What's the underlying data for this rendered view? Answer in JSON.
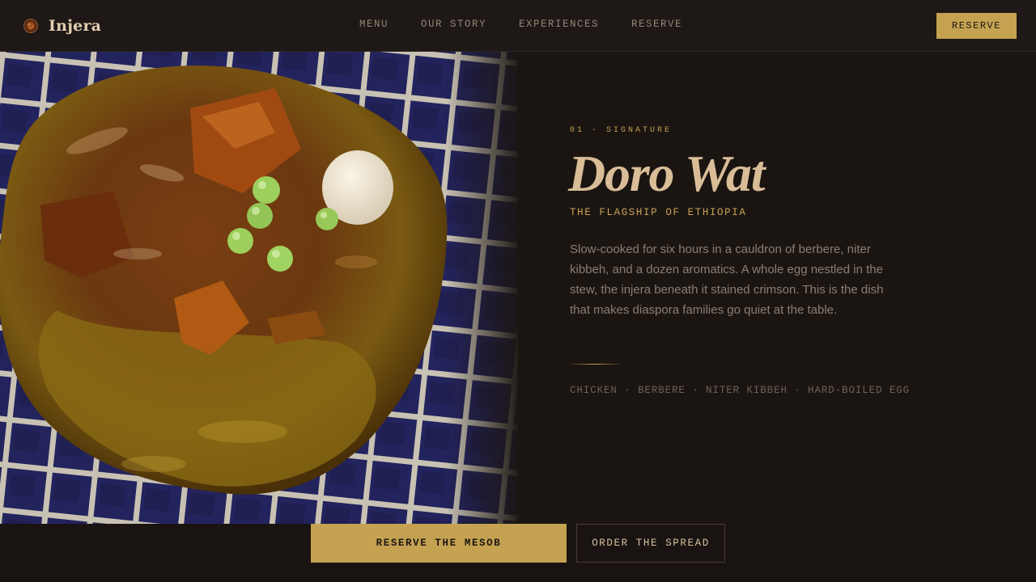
{
  "header": {
    "brand_name": "Injera",
    "brand_icon": "injera-bowl-icon",
    "nav": [
      {
        "label": "MENU"
      },
      {
        "label": "OUR STORY"
      },
      {
        "label": "EXPERIENCES"
      },
      {
        "label": "RESERVE"
      }
    ],
    "reserve_label": "RESERVE"
  },
  "hero": {
    "kicker": "01 · SIGNATURE",
    "title": "Doro Wat",
    "subtitle": "THE FLAGSHIP OF ETHIOPIA",
    "description": "Slow-cooked for six hours in a cauldron of berbere, niter kibbeh, and a dozen aromatics. A whole egg nestled in the stew, the injera beneath it stained crimson. This is the dish that makes diaspora families go quiet at the table.",
    "ingredients": "CHICKEN · BERBERE · NITER KIBBEH · HARD-BOILED EGG"
  },
  "cta": {
    "primary_label": "RESERVE THE MESOB",
    "secondary_label": "ORDER THE SPREAD"
  },
  "colors": {
    "background": "#1b1512",
    "accent_gold": "#c5a251",
    "title": "#d9bd97",
    "body_text": "#8a7e70",
    "muted_text": "#6a6057"
  }
}
